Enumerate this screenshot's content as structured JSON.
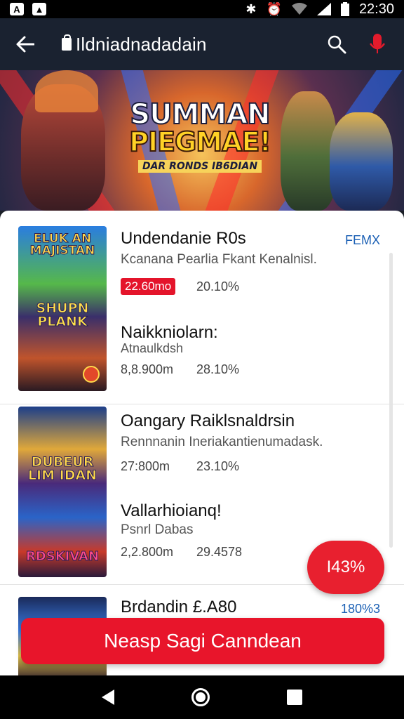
{
  "status": {
    "time": "22:30",
    "left_icons": [
      "A",
      "▲"
    ],
    "right_icons": [
      "bluetooth-icon",
      "alarm-icon",
      "wifi-icon",
      "signal-icon",
      "battery-icon"
    ]
  },
  "app_bar": {
    "title": "Ildniadnadadain"
  },
  "banner": {
    "title_line1": "SUMMAN",
    "title_line2": "PIEGMAE!",
    "tagline": "DAR RONDS IB6DIAN"
  },
  "items": [
    {
      "title": "Undendanie R0s",
      "subtitle": "Kcanana Pearlia Fkant Kenalnisl.",
      "price_badge": "22.60mo",
      "percent": "20.10%",
      "tag": "FEMX",
      "thumb_text_top": "ELUK AN MAJISTAN",
      "thumb_text_mid": "SHUPN PLANK"
    },
    {
      "title": "Naikkniolarn:",
      "subtitle": "Atnaulkdsh",
      "price": "8,8.900m",
      "percent": "28.10%"
    },
    {
      "title": "Oangary Raiklsnaldrsin",
      "subtitle": "Rennnanin Ineriakantienumadask.",
      "price": "27:800m",
      "percent": "23.10%",
      "thumb_text_mid": "DUBEUR LIM IDAN"
    },
    {
      "title": "Vallarhioianq!",
      "subtitle": "Psnrl Dabas",
      "price": "2,2.800m",
      "percent": "29.4578",
      "thumb_text_bottom": "RDSKIVAN"
    },
    {
      "title": "Brdandin £.A80",
      "tag": "180%3"
    }
  ],
  "fab": {
    "label": "I43%"
  },
  "cta": {
    "label": "Neasp Sagi Canndean"
  },
  "colors": {
    "accent": "#e8152b",
    "link_blue": "#1a5fb4",
    "app_bar": "#1a2230"
  }
}
